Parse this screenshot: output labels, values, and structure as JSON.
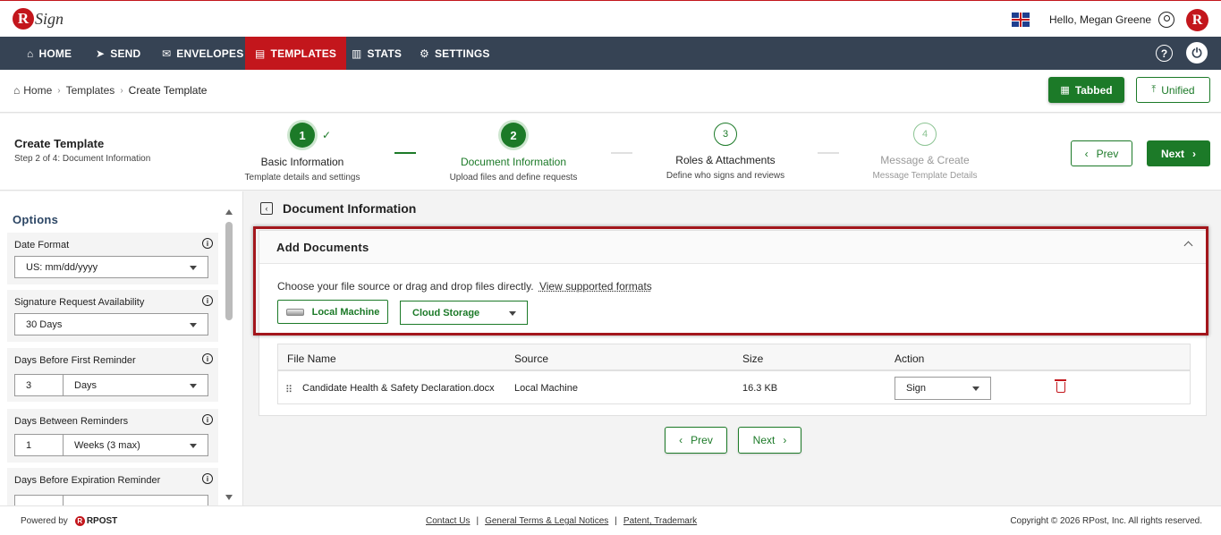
{
  "app": {
    "logo_letter": "R",
    "logo_text": "Sign",
    "greeting": "Hello, Megan Greene",
    "badge_letter": "R"
  },
  "nav": {
    "items": [
      {
        "label": "HOME",
        "icon": "home-icon"
      },
      {
        "label": "SEND",
        "icon": "send-icon"
      },
      {
        "label": "ENVELOPES",
        "icon": "envelope-icon"
      },
      {
        "label": "TEMPLATES",
        "icon": "template-icon",
        "active": true
      },
      {
        "label": "STATS",
        "icon": "stats-icon"
      },
      {
        "label": "SETTINGS",
        "icon": "gear-icon"
      }
    ],
    "help": "?",
    "power": "⏻"
  },
  "breadcrumb": {
    "home": "Home",
    "templates": "Templates",
    "current": "Create Template"
  },
  "view_toggle": {
    "tabbed": "Tabbed",
    "unified": "Unified"
  },
  "header": {
    "title": "Create Template",
    "subtitle": "Step 2 of 4: Document Information"
  },
  "steps": [
    {
      "number": "1",
      "label": "Basic Information",
      "sub": "Template details and settings",
      "state": "done"
    },
    {
      "number": "2",
      "label": "Document Information",
      "sub": "Upload files and define requests",
      "state": "current"
    },
    {
      "number": "3",
      "label": "Roles & Attachments",
      "sub": "Define who signs and reviews",
      "state": "todo"
    },
    {
      "number": "4",
      "label": "Message & Create",
      "sub": "Message Template Details",
      "state": "later"
    }
  ],
  "step_buttons": {
    "prev": "Prev",
    "next": "Next"
  },
  "options": {
    "title": "Options",
    "date_format": {
      "label": "Date Format",
      "value": "US: mm/dd/yyyy"
    },
    "availability": {
      "label": "Signature Request Availability",
      "value": "30 Days"
    },
    "first_reminder": {
      "label": "Days Before First Reminder",
      "number": "3",
      "unit": "Days"
    },
    "between_reminders": {
      "label": "Days Between Reminders",
      "number": "1",
      "unit": "Weeks (3 max)"
    },
    "expiration_reminder": {
      "label": "Days Before Expiration Reminder"
    }
  },
  "main": {
    "title": "Document Information",
    "add_documents": {
      "title": "Add Documents",
      "instruction": "Choose your file source or drag and drop files directly.",
      "formats_link": "View supported formats",
      "local_button": "Local Machine",
      "cloud_select": "Cloud Storage"
    },
    "table": {
      "headers": {
        "name": "File Name",
        "source": "Source",
        "size": "Size",
        "action": "Action"
      },
      "rows": [
        {
          "name": "Candidate Health & Safety Declaration.docx",
          "source": "Local Machine",
          "size": "16.3 KB",
          "action": "Sign"
        }
      ]
    },
    "prev": "Prev",
    "next": "Next"
  },
  "footer": {
    "powered_by": "Powered by",
    "brand": "RPOST",
    "links": [
      "Contact Us",
      "General Terms & Legal Notices",
      "Patent, Trademark"
    ],
    "copyright": "Copyright © 2026 RPost, Inc. All rights reserved."
  },
  "colors": {
    "brand_red": "#c3161c",
    "nav_bg": "#364354",
    "accent_green": "#1c7a28"
  }
}
